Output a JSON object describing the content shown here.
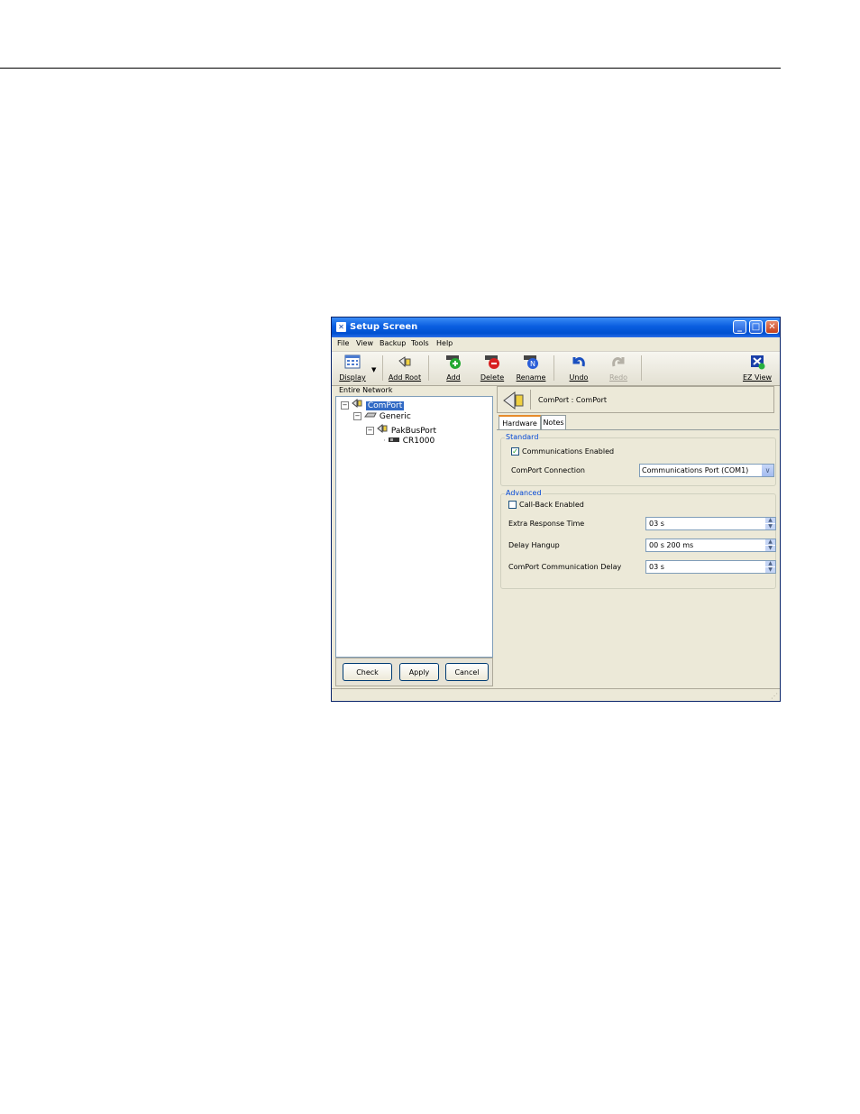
{
  "window": {
    "title": "Setup Screen",
    "title_icon": "app-icon"
  },
  "menu": [
    "File",
    "View",
    "Backup",
    "Tools",
    "Help"
  ],
  "toolbar": {
    "display": "Display",
    "add_root": "Add Root",
    "add": "Add",
    "delete": "Delete",
    "rename": "Rename",
    "undo": "Undo",
    "redo": "Redo",
    "ez_view": "EZ View"
  },
  "tree": {
    "header": "Entire Network",
    "nodes": [
      {
        "label": "ComPort",
        "icon": "comport-icon",
        "selected": true
      },
      {
        "label": "Generic",
        "icon": "modem-icon"
      },
      {
        "label": "PakBusPort",
        "icon": "pakbus-icon"
      },
      {
        "label": "CR1000",
        "icon": "datalogger-icon"
      }
    ]
  },
  "buttons": {
    "check": "Check",
    "apply": "Apply",
    "cancel": "Cancel"
  },
  "detail": {
    "header": "ComPort : ComPort",
    "tabs": [
      "Hardware",
      "Notes"
    ],
    "standard": {
      "title": "Standard",
      "comms_enabled_label": "Communications Enabled",
      "comms_enabled": true,
      "connection_label": "ComPort Connection",
      "connection_value": "Communications Port (COM1)"
    },
    "advanced": {
      "title": "Advanced",
      "callback_label": "Call-Back Enabled",
      "callback_enabled": false,
      "extra_response_label": "Extra Response Time",
      "extra_response_value": "03 s",
      "delay_hangup_label": "Delay Hangup",
      "delay_hangup_value": "00 s 200 ms",
      "comport_delay_label": "ComPort Communication Delay",
      "comport_delay_value": "03 s"
    }
  },
  "colors": {
    "titlebar": "#0a5ee0",
    "selection": "#316ac5",
    "group_title": "#0046d5"
  }
}
